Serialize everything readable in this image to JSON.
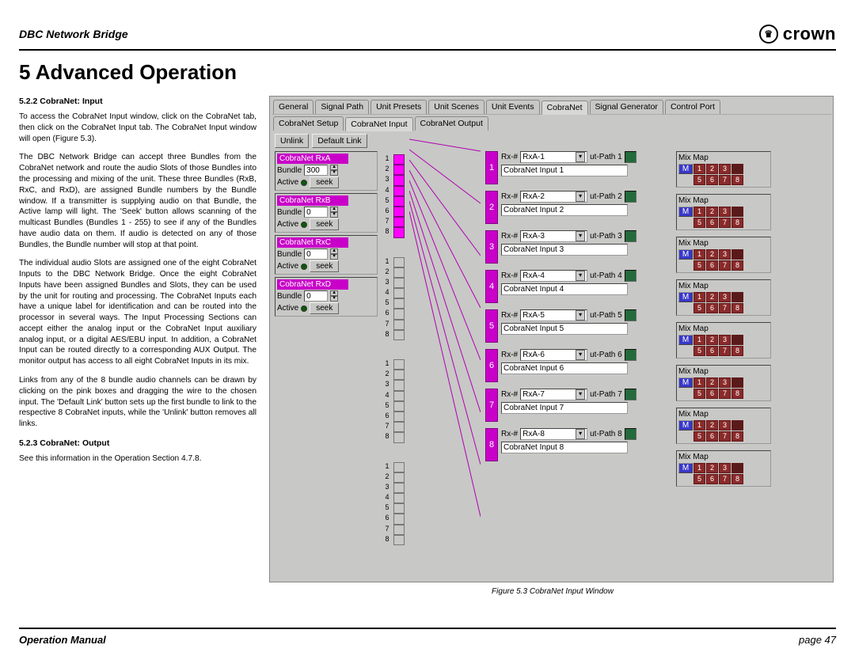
{
  "header": {
    "product": "DBC Network Bridge",
    "brand": "crown"
  },
  "heading": "5 Advanced Operation",
  "section1": {
    "title": "5.2.2 CobraNet: Input",
    "p1": "To access the CobraNet Input window, click on the CobraNet tab, then click on the CobraNet Input tab. The CobraNet Input window will open (Figure 5.3).",
    "p2": "The DBC Network Bridge can accept three Bundles from the CobraNet network and route the audio Slots of those Bundles into the processing and mixing of the unit. These three Bundles (RxB, RxC, and RxD), are assigned Bundle numbers by the Bundle window. If a transmitter is supplying audio on that Bundle, the Active lamp will light. The 'Seek' button allows scanning of the multicast Bundles (Bundles 1 - 255) to see if any of the Bundles have audio data on them. If audio is detected on any of those Bundles, the Bundle number will stop at that point.",
    "p3": "The individual audio Slots are assigned one of the eight CobraNet Inputs to the DBC Network Bridge. Once the eight CobraNet Inputs have been assigned Bundles and Slots, they can be used by the unit for routing and processing. The CobraNet Inputs each have a unique label for identification and can be routed into the processor in several ways. The Input Processing Sections can accept either the analog input or the CobraNet Input auxiliary analog input, or a digital AES/EBU input. In addition, a CobraNet Input can be routed directly to a corresponding AUX Output. The monitor output has access to all eight CobraNet Inputs in its mix.",
    "p4": "Links from any of the 8 bundle audio channels can be drawn by clicking on the pink boxes and dragging the wire to the chosen input. The 'Default Link' button sets up the first bundle to link to the respective 8 CobraNet inputs, while the 'Unlink' button removes all links."
  },
  "section2": {
    "title": "5.2.3 CobraNet: Output",
    "p1": "See this information in the Operation Section 4.7.8."
  },
  "ui": {
    "tabs": [
      "General",
      "Signal Path",
      "Unit Presets",
      "Unit Scenes",
      "Unit Events",
      "CobraNet",
      "Signal Generator",
      "Control Port"
    ],
    "activeTab": "CobraNet",
    "subtabs": [
      "CobraNet Setup",
      "CobraNet Input",
      "CobraNet Output"
    ],
    "activeSubtab": "CobraNet Input",
    "unlink": "Unlink",
    "defaultLink": "Default Link",
    "bundleLabel": "Bundle",
    "activeLabel": "Active",
    "seek": "seek",
    "rx": [
      {
        "title": "CobraNet RxA",
        "bundle": "300"
      },
      {
        "title": "CobraNet RxB",
        "bundle": "0"
      },
      {
        "title": "CobraNet RxC",
        "bundle": "0"
      },
      {
        "title": "CobraNet RxD",
        "bundle": "0"
      }
    ],
    "rxLabel": "Rx-#",
    "pathSuffix": "ut-Path",
    "mixLabel": "Mix Map",
    "mLabel": "M",
    "inputs": [
      {
        "n": "1",
        "rx": "RxA-1",
        "name": "CobraNet Input 1"
      },
      {
        "n": "2",
        "rx": "RxA-2",
        "name": "CobraNet Input 2"
      },
      {
        "n": "3",
        "rx": "RxA-3",
        "name": "CobraNet Input 3"
      },
      {
        "n": "4",
        "rx": "RxA-4",
        "name": "CobraNet Input 4"
      },
      {
        "n": "5",
        "rx": "RxA-5",
        "name": "CobraNet Input 5"
      },
      {
        "n": "6",
        "rx": "RxA-6",
        "name": "CobraNet Input 6"
      },
      {
        "n": "7",
        "rx": "RxA-7",
        "name": "CobraNet Input 7"
      },
      {
        "n": "8",
        "rx": "RxA-8",
        "name": "CobraNet Input 8"
      }
    ]
  },
  "caption": "Figure 5.3  CobraNet Input Window",
  "footer": {
    "left": "Operation Manual",
    "right": "page 47"
  }
}
